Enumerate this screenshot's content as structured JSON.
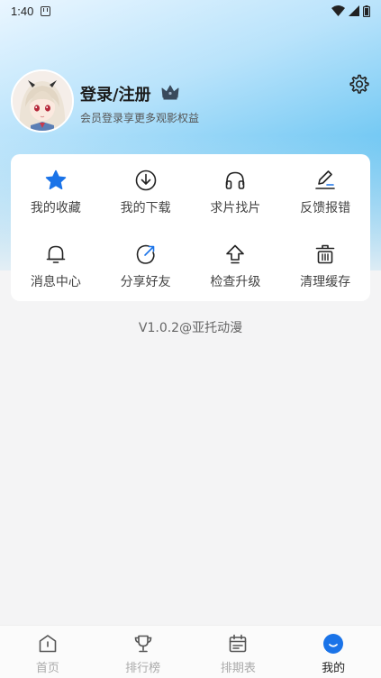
{
  "status_bar": {
    "time": "1:40"
  },
  "profile": {
    "title": "登录/注册",
    "subtitle": "会员登录享更多观影权益"
  },
  "grid": [
    {
      "label": "我的收藏",
      "icon": "star-icon"
    },
    {
      "label": "我的下载",
      "icon": "download-icon"
    },
    {
      "label": "求片找片",
      "icon": "headphones-icon"
    },
    {
      "label": "反馈报错",
      "icon": "edit-icon"
    },
    {
      "label": "消息中心",
      "icon": "bell-icon"
    },
    {
      "label": "分享好友",
      "icon": "share-icon"
    },
    {
      "label": "检查升级",
      "icon": "upgrade-icon"
    },
    {
      "label": "清理缓存",
      "icon": "basket-icon"
    }
  ],
  "version": "V1.0.2@亚托动漫",
  "tabbar": [
    {
      "label": "首页",
      "icon": "home-icon",
      "active": false
    },
    {
      "label": "排行榜",
      "icon": "trophy-icon",
      "active": false
    },
    {
      "label": "排期表",
      "icon": "calendar-icon",
      "active": false
    },
    {
      "label": "我的",
      "icon": "profile-icon",
      "active": true
    }
  ],
  "colors": {
    "accent": "#1a73e8",
    "inactive": "#aaaaaa"
  }
}
